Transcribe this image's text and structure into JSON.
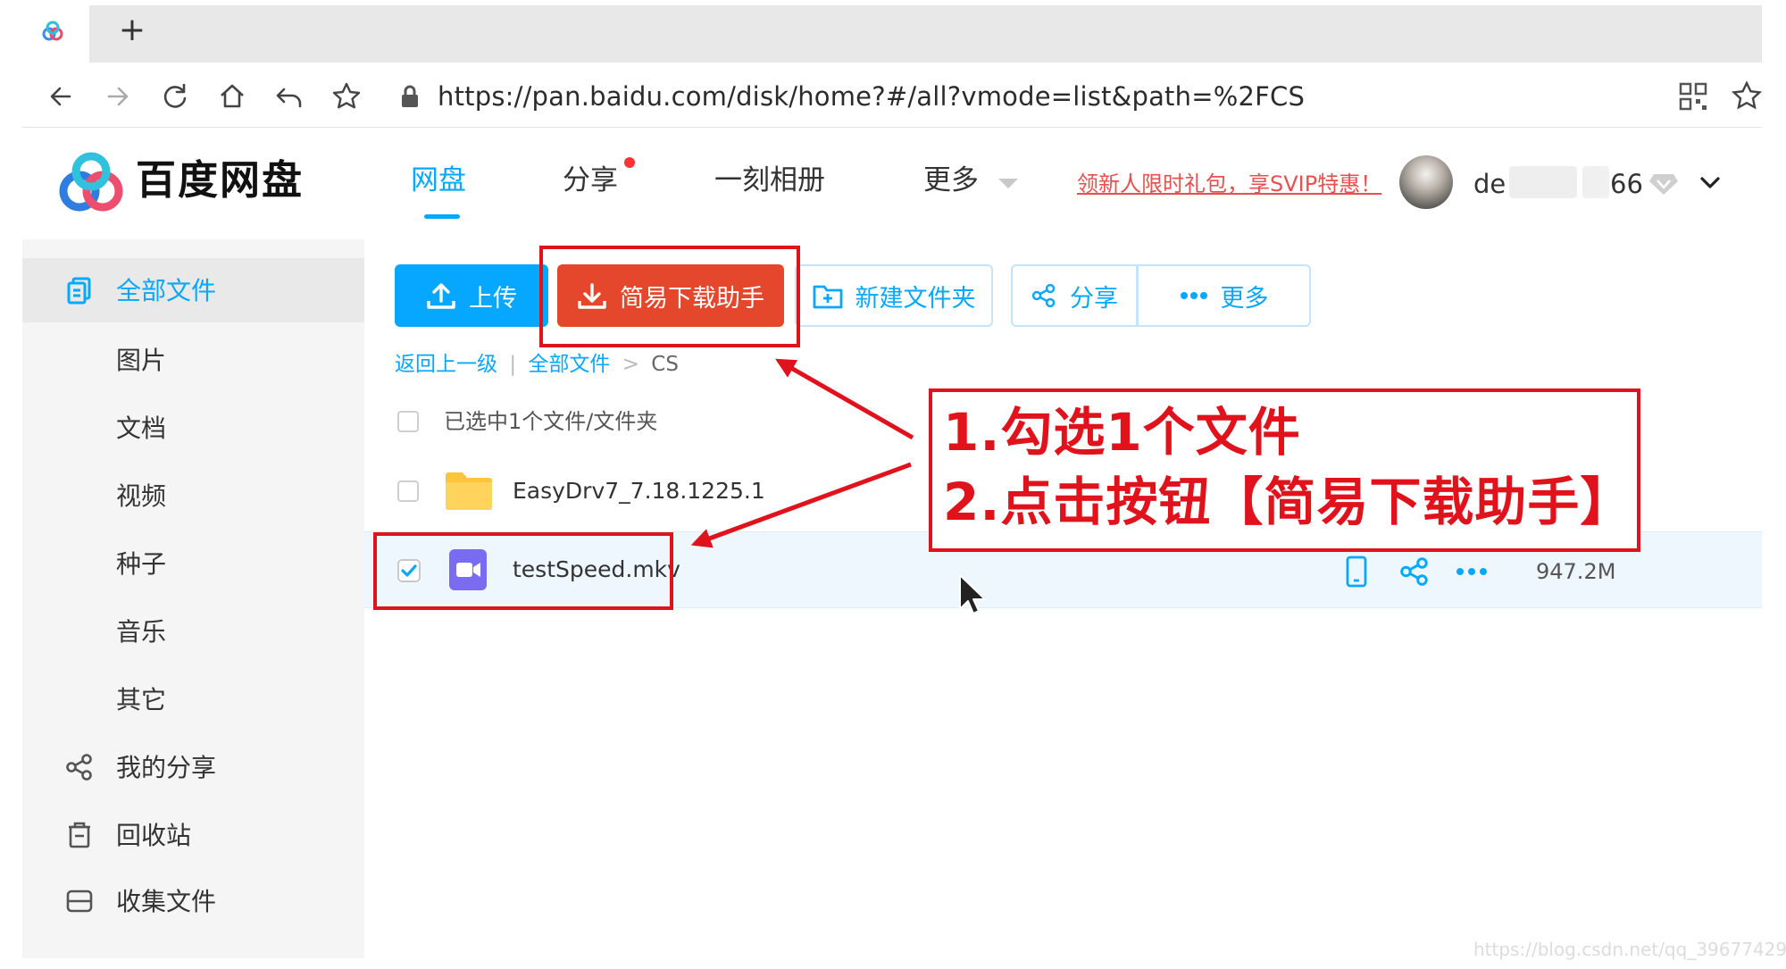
{
  "browser": {
    "url": "https://pan.baidu.com/disk/home?#/all?vmode=list&path=%2FCS",
    "new_tab_label": "+"
  },
  "header": {
    "brand": "百度网盘",
    "nav": [
      {
        "label": "网盘",
        "active": true
      },
      {
        "label": "分享",
        "has_dot": true
      },
      {
        "label": "一刻相册"
      },
      {
        "label": "更多"
      }
    ],
    "promo": "领新人限时礼包，享SVIP特惠！",
    "user": {
      "name_prefix": "de",
      "name_suffix": "66"
    }
  },
  "sidebar": {
    "items": [
      {
        "label": "全部文件",
        "icon": "files-icon",
        "selected": true
      },
      {
        "label": "图片"
      },
      {
        "label": "文档"
      },
      {
        "label": "视频"
      },
      {
        "label": "种子"
      },
      {
        "label": "音乐"
      },
      {
        "label": "其它"
      },
      {
        "label": "我的分享",
        "icon": "share-icon"
      },
      {
        "label": "回收站",
        "icon": "trash-icon"
      },
      {
        "label": "收集文件",
        "icon": "collect-icon"
      }
    ]
  },
  "toolbar": {
    "upload": "上传",
    "easy_download": "简易下载助手",
    "new_folder": "新建文件夹",
    "share": "分享",
    "more": "更多"
  },
  "breadcrumb": {
    "back": "返回上一级",
    "divider": "|",
    "root": "全部文件",
    "sep": ">",
    "current": "CS"
  },
  "file_list": {
    "selection_summary": "已选中1个文件/文件夹",
    "items": [
      {
        "name": "EasyDrv7_7.18.1225.1",
        "type": "folder",
        "checked": false,
        "size": ""
      },
      {
        "name": "testSpeed.mkv",
        "type": "video",
        "checked": true,
        "size": "947.2M"
      }
    ]
  },
  "annotation": {
    "line1": "1.勾选1个文件",
    "line2": "2.点击按钮【简易下载助手】",
    "color": "#e0121b"
  },
  "colors": {
    "accent": "#06a7ff",
    "easy_download_bg": "#e4472b",
    "promo": "#e85050"
  },
  "watermark": "https://blog.csdn.net/qq_39677429"
}
